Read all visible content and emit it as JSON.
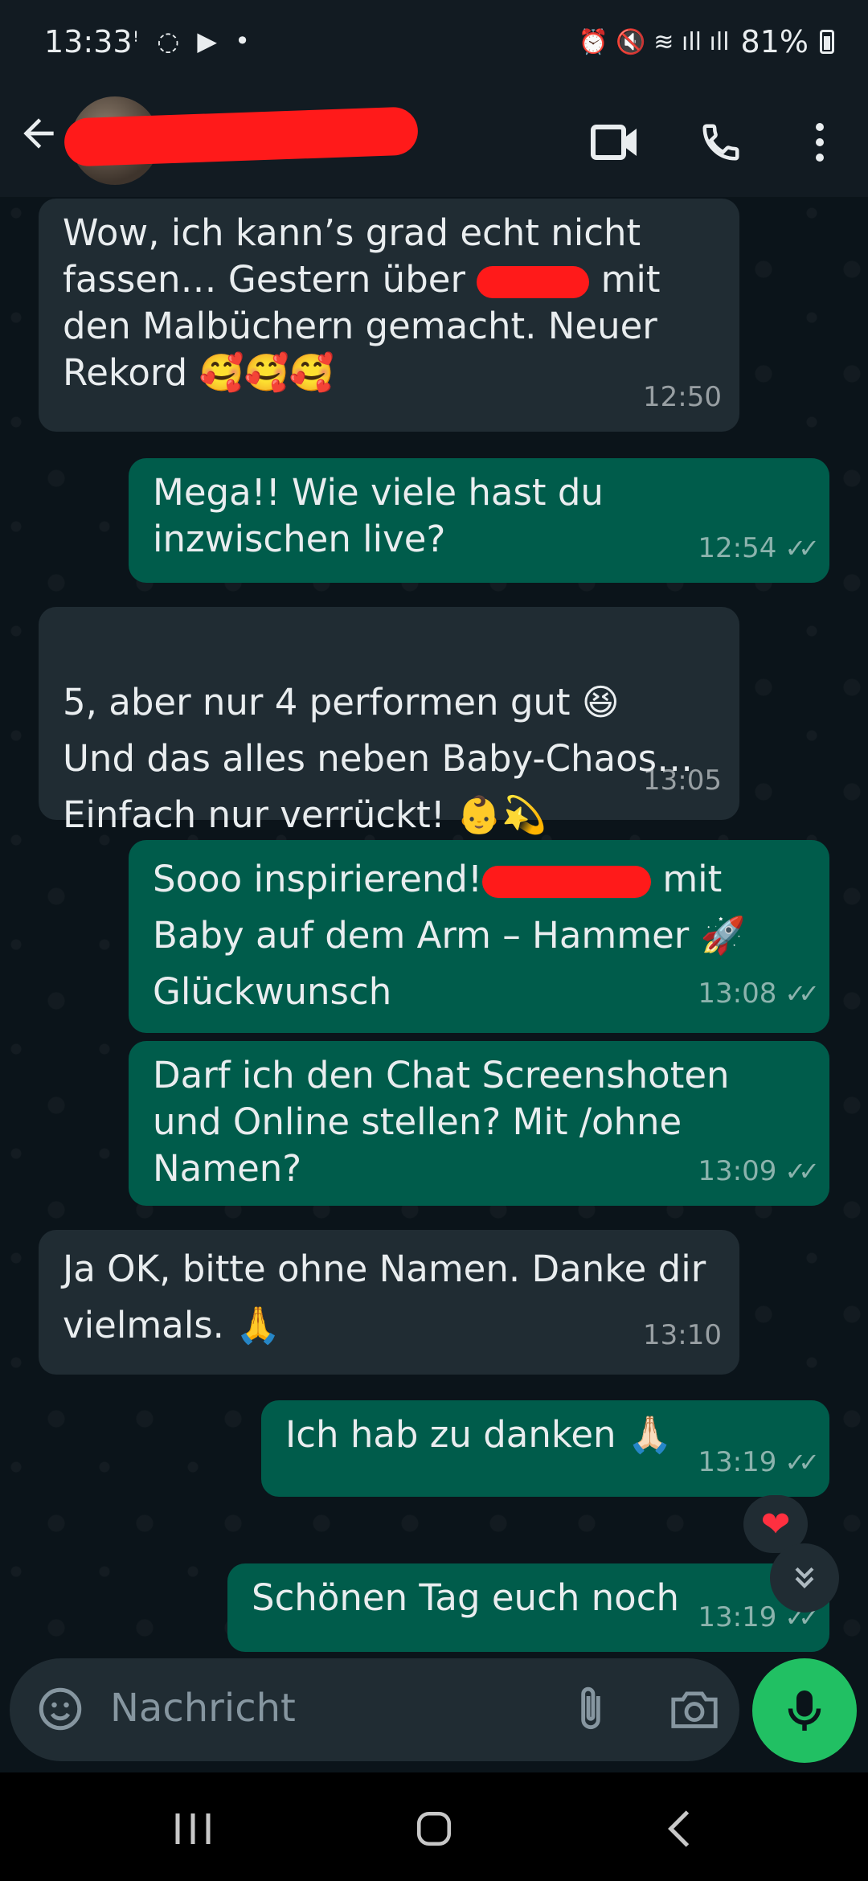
{
  "status_bar": {
    "time": "13:33",
    "left_icons": "ꜝ ◌ ▶ •",
    "right_icons": "⏰ 🔇 ≋ ıll ıll",
    "battery": "81%"
  },
  "header": {
    "contact_name": "",
    "icons": [
      "back-arrow-icon",
      "video-call-icon",
      "phone-icon",
      "more-vert-icon"
    ]
  },
  "messages": [
    {
      "dir": "in",
      "parts": [
        "Wow, ich kann’s grad echt nicht fassen… Gestern über ",
        " mit den Malbüchern gemacht. Neuer Rekord 🥰🥰🥰"
      ],
      "time": "12:50"
    },
    {
      "dir": "out",
      "text": "Mega!! Wie viele hast du inzwischen live?",
      "time": "12:54"
    },
    {
      "dir": "in",
      "text": "5, aber nur 4 performen gut 😆\nUnd das alles neben Baby-Chaos…\nEinfach nur verrückt! 👶💫",
      "time": "13:05"
    },
    {
      "dir": "out",
      "parts": [
        "Sooo inspirierend!",
        " mit Baby auf dem Arm – Hammer 🚀 Glückwunsch"
      ],
      "time": "13:08"
    },
    {
      "dir": "out",
      "text": "Darf ich den Chat Screenshoten und Online stellen? Mit /ohne Namen?",
      "time": "13:09"
    },
    {
      "dir": "in",
      "text": "Ja OK, bitte ohne Namen. Danke dir vielmals. 🙏",
      "time": "13:10"
    },
    {
      "dir": "out",
      "text": "Ich hab zu danken 🙏🏻",
      "time": "13:19",
      "reaction": "❤"
    },
    {
      "dir": "out",
      "text": "Schönen Tag euch noch",
      "time": "13:19"
    }
  ],
  "input": {
    "placeholder": "Nachricht"
  },
  "colors": {
    "background": "#0b141a",
    "incoming_bubble": "#202c33",
    "outgoing_bubble": "#005c4b",
    "mic_button": "#21c063",
    "redaction": "#ff1a1a"
  }
}
